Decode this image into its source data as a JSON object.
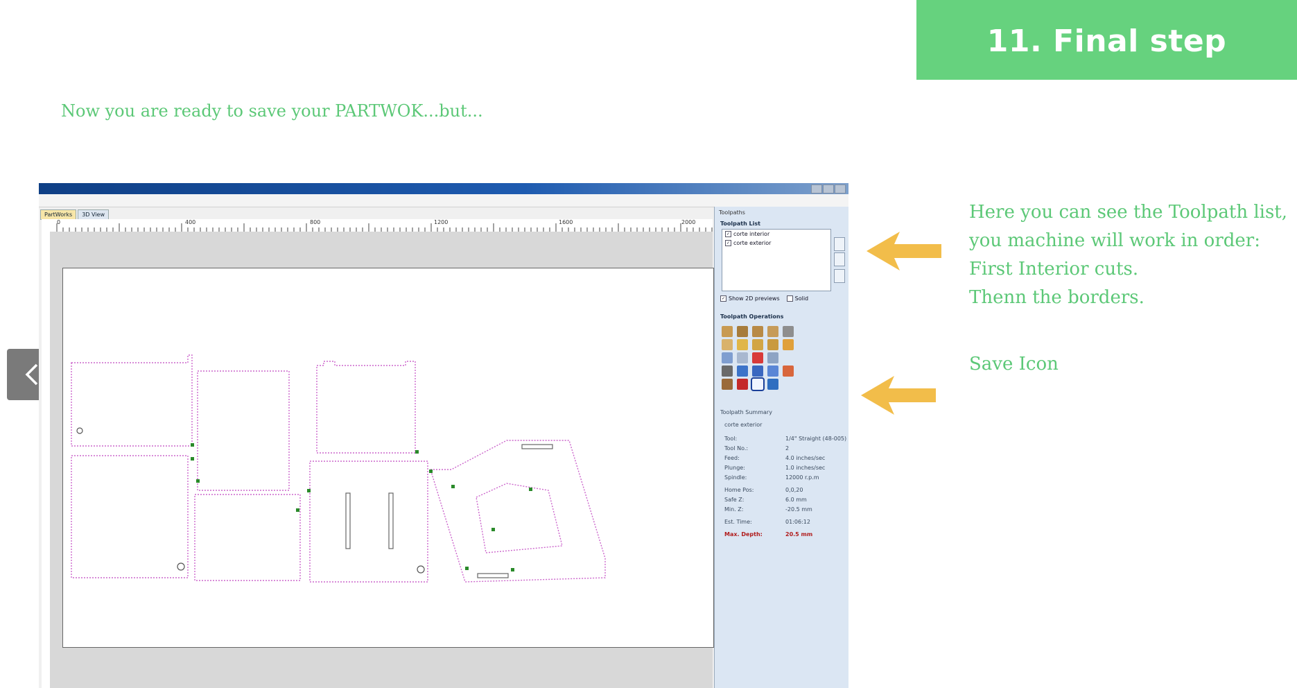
{
  "banner": {
    "title": "11. Final step"
  },
  "intro": "Now you are ready to save your PARTWOK...but...",
  "nav": {
    "prev_icon": "chevron-left-icon"
  },
  "software": {
    "tabs": [
      "PartWorks",
      "3D View"
    ],
    "ruler_labels": [
      "0",
      "400",
      "800",
      "1200",
      "1600",
      "2000"
    ],
    "panel": {
      "caption": "Toolpaths",
      "list_title": "Toolpath List",
      "toolpaths": [
        "corte interior",
        "corte exterior"
      ],
      "show_2d": "Show 2D previews",
      "solid": "Solid",
      "ops_title": "Toolpath Operations",
      "summary_title": "Toolpath Summary",
      "summary_name": "corte exterior",
      "summary": [
        {
          "k": "Tool:",
          "v": "1/4\" Straight  (48-005)"
        },
        {
          "k": "Tool No.:",
          "v": "2"
        },
        {
          "k": "Feed:",
          "v": "4.0 inches/sec"
        },
        {
          "k": "Plunge:",
          "v": "1.0 inches/sec"
        },
        {
          "k": "Spindle:",
          "v": "12000 r.p.m"
        },
        {
          "k": "Home Pos:",
          "v": "0,0,20"
        },
        {
          "k": "Safe Z:",
          "v": "6.0 mm"
        },
        {
          "k": "Min. Z:",
          "v": "-20.5 mm"
        },
        {
          "k": "Est. Time:",
          "v": "01:06:12"
        },
        {
          "k": "Max. Depth:",
          "v": "20.5 mm"
        }
      ]
    }
  },
  "notes": {
    "lines": [
      "Here you can see the Toolpath list,",
      "you machine will work in order:",
      "First Interior cuts.",
      "Thenn the borders."
    ],
    "save": "Save Icon"
  },
  "colors": {
    "accent": "#66d27e",
    "text_green": "#5cc877",
    "arrow": "#f2bd4a",
    "toolpath": "#cc66cc"
  }
}
